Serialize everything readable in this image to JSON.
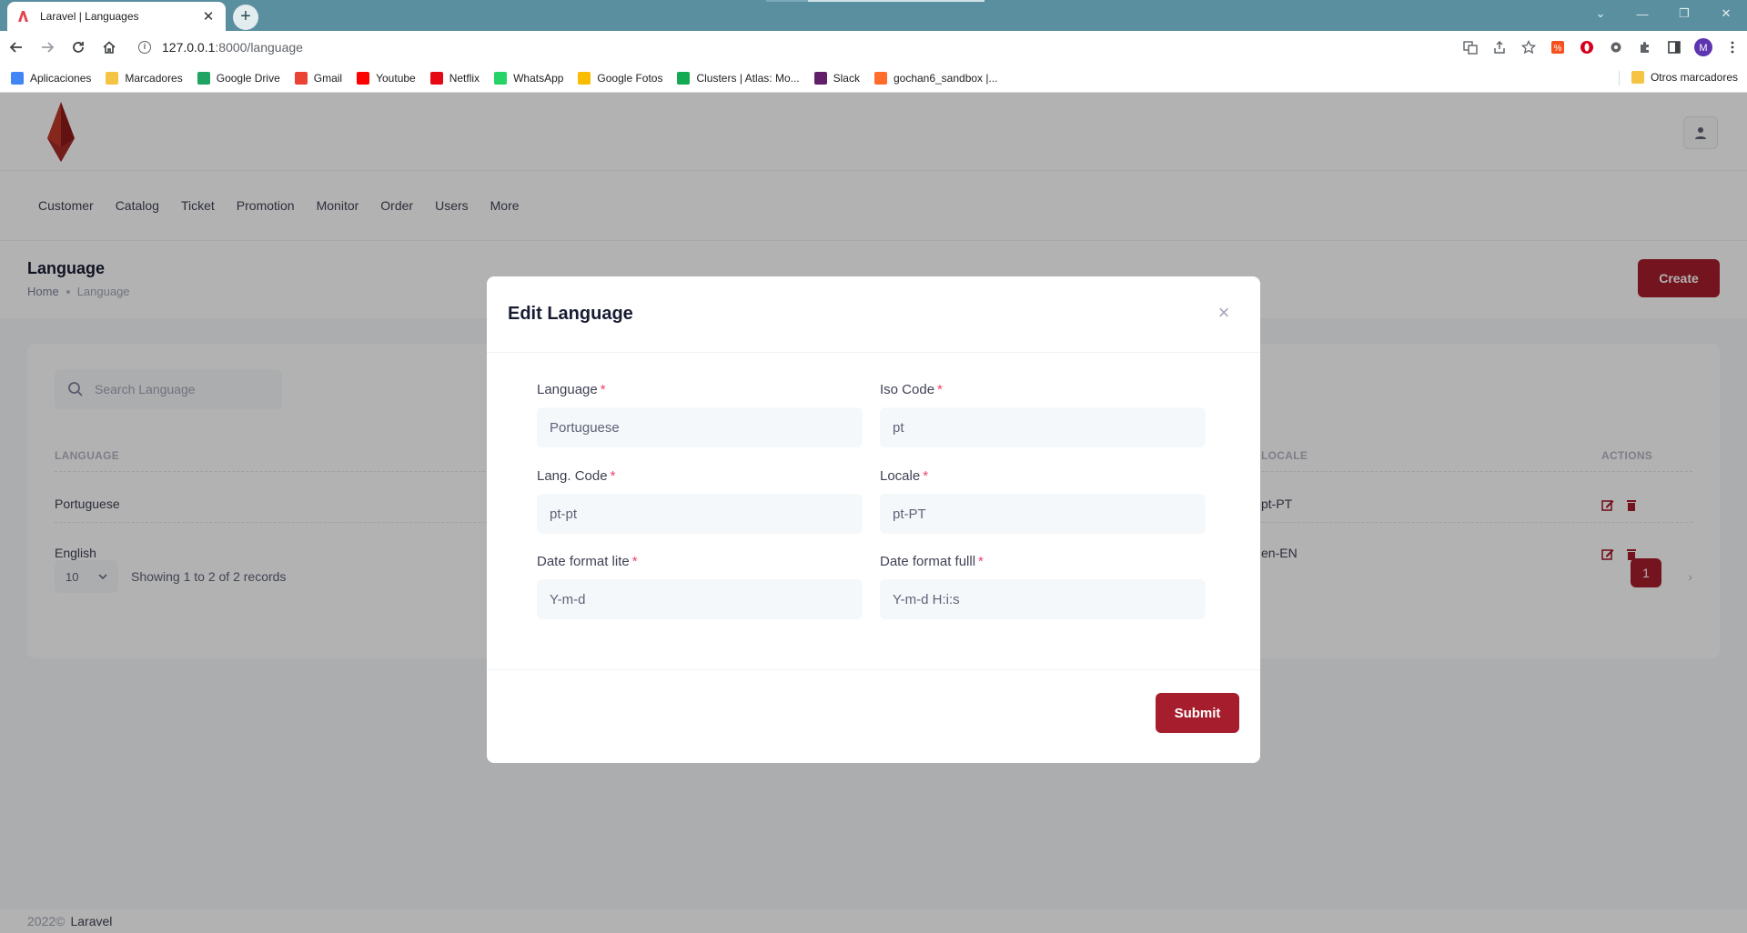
{
  "browser": {
    "tab_title": "Laravel | Languages",
    "tab_close": "✕",
    "new_tab": "+",
    "url_host": "127.0.0.1",
    "url_path": ":8000/language",
    "bookmarks": [
      {
        "label": "Aplicaciones",
        "icon": "apps-grid-icon",
        "color": "#4285f4"
      },
      {
        "label": "Marcadores",
        "icon": "folder-icon",
        "color": "#f6c445"
      },
      {
        "label": "Google Drive",
        "icon": "google-drive-icon",
        "color": "#1fa463"
      },
      {
        "label": "Gmail",
        "icon": "gmail-icon",
        "color": "#ea4335"
      },
      {
        "label": "Youtube",
        "icon": "youtube-icon",
        "color": "#ff0000"
      },
      {
        "label": "Netflix",
        "icon": "netflix-icon",
        "color": "#e50914"
      },
      {
        "label": "WhatsApp",
        "icon": "whatsapp-icon",
        "color": "#25d366"
      },
      {
        "label": "Google Fotos",
        "icon": "google-photos-icon",
        "color": "#fbbc04"
      },
      {
        "label": "Clusters | Atlas: Mo...",
        "icon": "mongodb-icon",
        "color": "#13aa52"
      },
      {
        "label": "Slack",
        "icon": "slack-icon",
        "color": "#611f69"
      },
      {
        "label": "gochan6_sandbox |...",
        "icon": "cpanel-icon",
        "color": "#ff6c2c"
      }
    ],
    "other_bookmarks": "Otros marcadores",
    "profile_initial": "M"
  },
  "app": {
    "menu": [
      "Customer",
      "Catalog",
      "Ticket",
      "Promotion",
      "Monitor",
      "Order",
      "Users",
      "More"
    ],
    "page_title": "Language",
    "breadcrumb": {
      "home": "Home",
      "current": "Language"
    },
    "create_label": "Create",
    "search_placeholder": "Search Language",
    "table": {
      "headers": {
        "language": "LANGUAGE",
        "locale": "LOCALE",
        "actions": "ACTIONS"
      },
      "rows": [
        {
          "language": "Portuguese",
          "locale": "pt-PT"
        },
        {
          "language": "English",
          "locale": "en-EN"
        }
      ]
    },
    "per_page": "10",
    "showing": "Showing 1 to 2 of 2 records",
    "current_page": "1",
    "footer_year": "2022©",
    "footer_brand": "Laravel",
    "brand_color": "#a61e2d"
  },
  "modal": {
    "title": "Edit Language",
    "close": "×",
    "required_mark": "*",
    "fields": {
      "language": {
        "label": "Language",
        "value": "Portuguese"
      },
      "iso_code": {
        "label": "Iso Code",
        "value": "pt"
      },
      "lang_code": {
        "label": "Lang. Code",
        "value": "pt-pt"
      },
      "locale": {
        "label": "Locale",
        "value": "pt-PT"
      },
      "date_lite": {
        "label": "Date format lite",
        "value": "Y-m-d"
      },
      "date_full": {
        "label": "Date format fulll",
        "value": "Y-m-d H:i:s"
      }
    },
    "submit_label": "Submit"
  }
}
